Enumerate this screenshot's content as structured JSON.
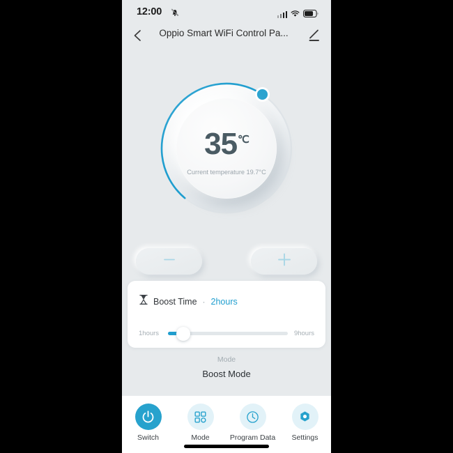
{
  "status_bar": {
    "time": "12:00",
    "mute_icon": "bell-mute-icon",
    "signal_icon": "signal-bars-icon",
    "wifi_icon": "wifi-icon",
    "battery_icon": "battery-icon",
    "battery_level_pct": 70
  },
  "header": {
    "back_icon": "chevron-left-icon",
    "title": "Oppio Smart WiFi Control Pa...",
    "edit_icon": "pencil-icon"
  },
  "dial": {
    "target_temperature": "35",
    "unit": "℃",
    "current_temperature_text": "Current temperature 19.7°C",
    "arc_color": "#1f9ecf",
    "knob_color": "#2ba3cf",
    "progress_pct": 62
  },
  "stepper": {
    "decrease_label": "−",
    "decrease_icon": "minus-icon",
    "increase_label": "+",
    "increase_icon": "plus-icon"
  },
  "boost_card": {
    "icon": "hourglass-icon",
    "label": "Boost Time",
    "separator": "·",
    "value": "2hours",
    "slider": {
      "min_label": "1hours",
      "max_label": "9hours",
      "min": 1,
      "max": 9,
      "current": 2,
      "fill_pct": 13,
      "fill_color": "#1f9ecf"
    }
  },
  "mode_section": {
    "caption": "Mode",
    "value": "Boost Mode"
  },
  "bottom_nav": {
    "items": [
      {
        "label": "Switch",
        "icon": "power-icon",
        "active": true
      },
      {
        "label": "Mode",
        "icon": "grid-icon",
        "active": false
      },
      {
        "label": "Program Data",
        "icon": "clock-icon",
        "active": false
      },
      {
        "label": "Settings",
        "icon": "hex-gear-icon",
        "active": false
      }
    ],
    "accent_color": "#27a2cd",
    "inactive_bg": "#e2f2f8"
  }
}
